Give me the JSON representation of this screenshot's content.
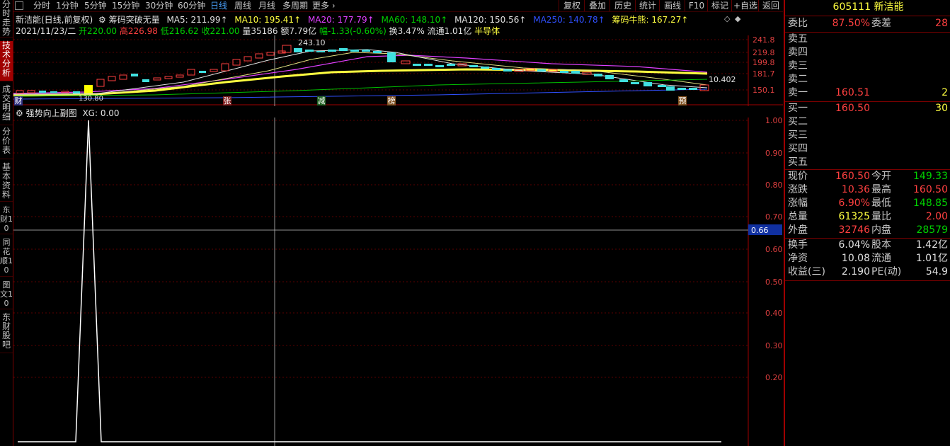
{
  "left_tabs": [
    {
      "label": "分时走势",
      "active": false
    },
    {
      "label": "技术分析",
      "active": true
    },
    {
      "label": "成交明细",
      "active": false
    },
    {
      "label": "分价表",
      "active": false
    },
    {
      "label": "基本资料",
      "active": false
    },
    {
      "label": "东财10",
      "active": false
    },
    {
      "label": "同花顺10",
      "active": false
    },
    {
      "label": "图文10",
      "active": false
    },
    {
      "label": "东财股吧",
      "active": false
    }
  ],
  "periods": [
    "分时",
    "1分钟",
    "5分钟",
    "15分钟",
    "30分钟",
    "60分钟",
    "日线",
    "周线",
    "月线",
    "多周期",
    "更多 ›"
  ],
  "active_period": "日线",
  "toolbar": [
    "复权",
    "叠加",
    "历史",
    "统计",
    "画线",
    "F10",
    "标记",
    "+自选",
    "返回"
  ],
  "header": {
    "title": "新洁能(日线,前复权)",
    "indicator_name": "筹码突破无量",
    "ma5": "MA5: 211.99↑",
    "ma10": "MA10: 195.41↑",
    "ma20": "MA20: 177.79↑",
    "ma60": "MA60: 148.10↑",
    "ma120": "MA120: 150.56↑",
    "ma250": "MA250: 140.78↑",
    "chip_bull": "筹码牛熊: 167.27↑"
  },
  "day_info": {
    "date": "2021/11/23/二",
    "open": "开220.00",
    "high": "高226.98",
    "low": "低216.62",
    "close": "收221.00",
    "volume": "量35186",
    "amount": "额7.79亿",
    "change": "幅-1.33(-0.60%)",
    "turnover": "换3.47%",
    "float": "流通1.01亿",
    "sector": "半导体"
  },
  "main_chart": {
    "y_ticks": [
      "241.8",
      "219.8",
      "199.8",
      "181.7",
      "150.1"
    ],
    "peak_label": "243.10",
    "last_value": "10.402",
    "low_label": "130.80",
    "markers": [
      "财",
      "张",
      "减",
      "榜",
      "预"
    ]
  },
  "sub_chart": {
    "title": "强势向上副图",
    "xg": "XG: 0.00",
    "y_ticks": [
      "1.00",
      "0.90",
      "0.80",
      "0.70",
      "0.60",
      "0.50",
      "0.40",
      "0.30",
      "0.20"
    ],
    "cursor_value": "0.66"
  },
  "quote": {
    "code": "605111",
    "name": "新洁能",
    "weibi_label": "委比",
    "weibi": "87.50%",
    "weicha_label": "委差",
    "weicha": "28",
    "asks": [
      {
        "label": "卖五",
        "price": "",
        "vol": ""
      },
      {
        "label": "卖四",
        "price": "",
        "vol": ""
      },
      {
        "label": "卖三",
        "price": "",
        "vol": ""
      },
      {
        "label": "卖二",
        "price": "",
        "vol": ""
      },
      {
        "label": "卖一",
        "price": "160.51",
        "vol": "2"
      }
    ],
    "bids": [
      {
        "label": "买一",
        "price": "160.50",
        "vol": "30"
      },
      {
        "label": "买二",
        "price": "",
        "vol": ""
      },
      {
        "label": "买三",
        "price": "",
        "vol": ""
      },
      {
        "label": "买四",
        "price": "",
        "vol": ""
      },
      {
        "label": "买五",
        "price": "",
        "vol": ""
      }
    ],
    "stats": [
      {
        "l1": "现价",
        "v1": "160.50",
        "c1": "red",
        "l2": "今开",
        "v2": "149.33",
        "c2": "green"
      },
      {
        "l1": "涨跌",
        "v1": "10.36",
        "c1": "red",
        "l2": "最高",
        "v2": "160.50",
        "c2": "red"
      },
      {
        "l1": "涨幅",
        "v1": "6.90%",
        "c1": "red",
        "l2": "最低",
        "v2": "148.85",
        "c2": "green"
      },
      {
        "l1": "总量",
        "v1": "61325",
        "c1": "yellow",
        "l2": "量比",
        "v2": "2.00",
        "c2": "red"
      },
      {
        "l1": "外盘",
        "v1": "32746",
        "c1": "red",
        "l2": "内盘",
        "v2": "28579",
        "c2": "green"
      }
    ],
    "fundamentals": [
      {
        "l1": "换手",
        "v1": "6.04%",
        "l2": "股本",
        "v2": "1.42亿"
      },
      {
        "l1": "净资",
        "v1": "10.08",
        "l2": "流通",
        "v2": "1.01亿"
      },
      {
        "l1": "收益(三)",
        "v1": "2.190",
        "l2": "PE(动)",
        "v2": "54.9"
      }
    ]
  }
}
